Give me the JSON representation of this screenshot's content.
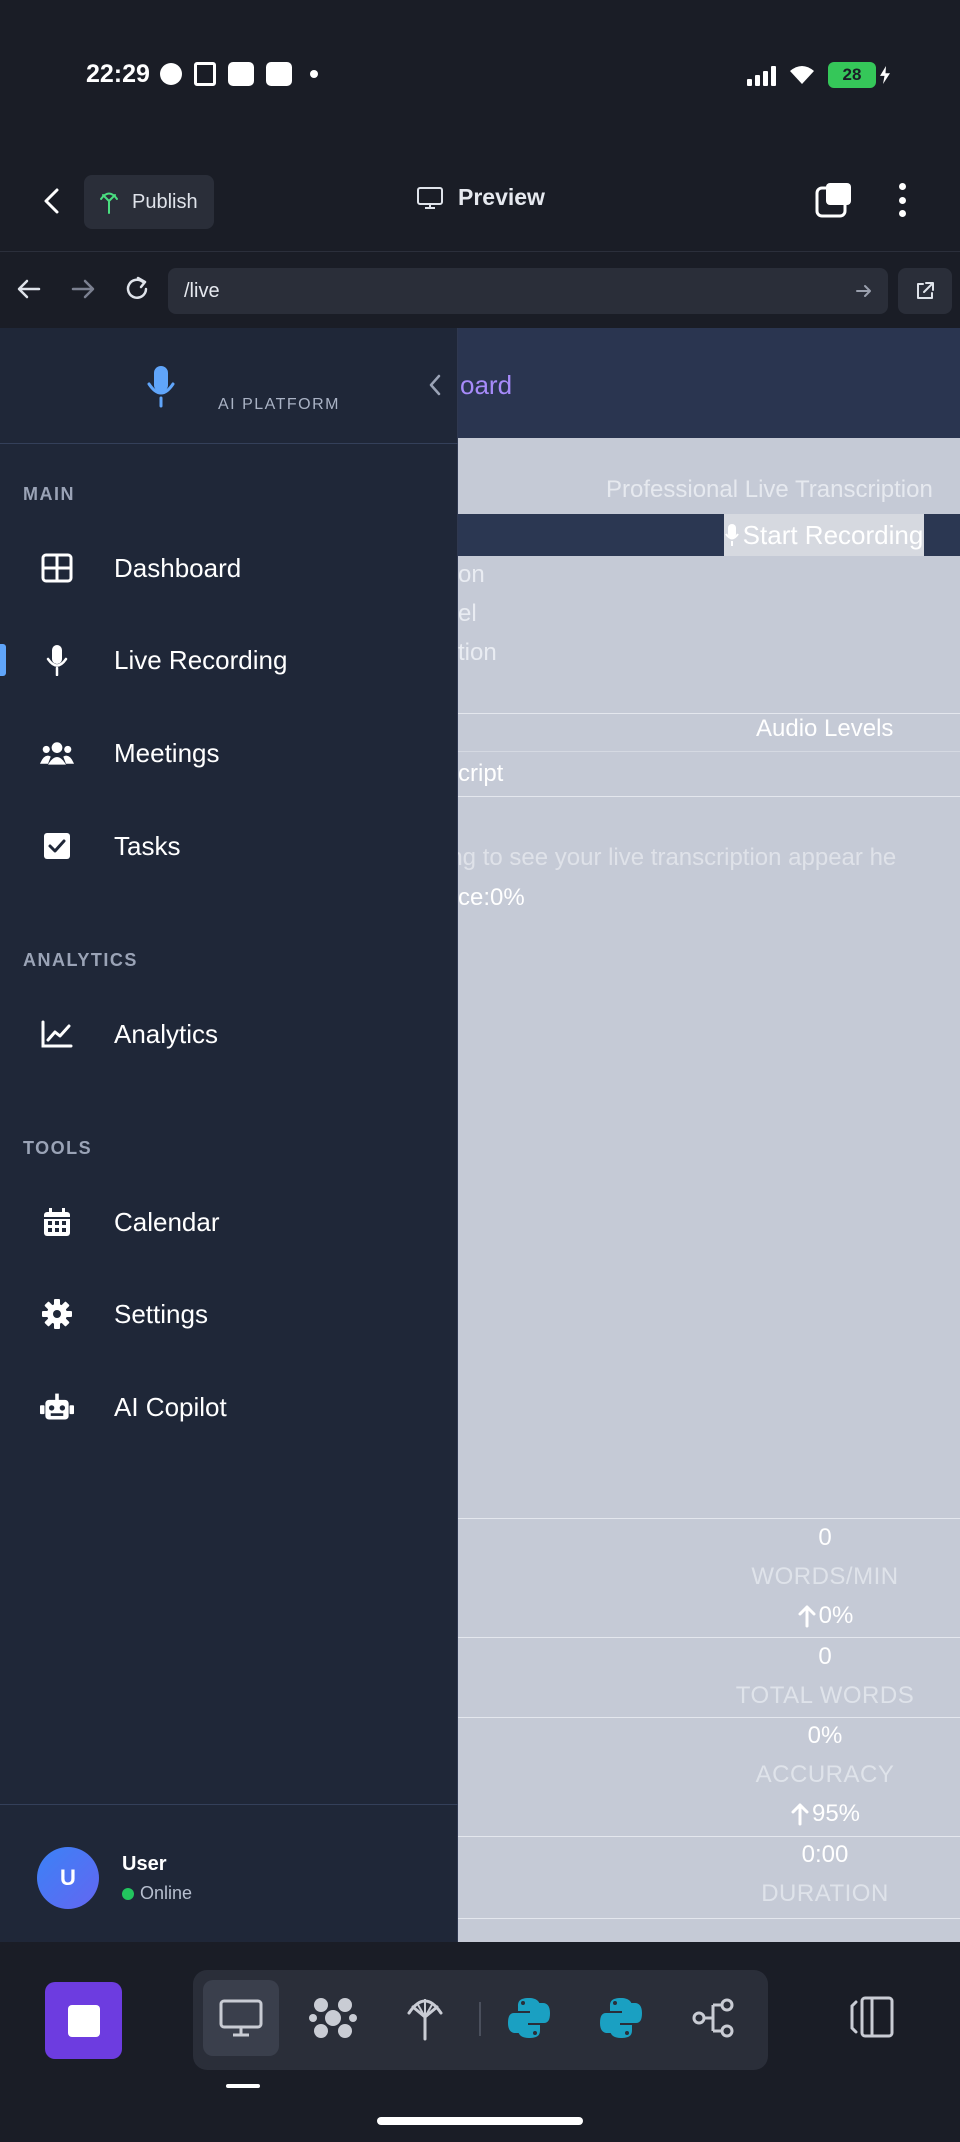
{
  "status_bar": {
    "time": "22:29",
    "battery": "28"
  },
  "app_bar": {
    "publish_label": "Publish",
    "preview_label": "Preview"
  },
  "browser": {
    "url": "/live"
  },
  "sidebar": {
    "brand": "AI PLATFORM",
    "groups": [
      {
        "label": "MAIN"
      },
      {
        "label": "ANALYTICS"
      },
      {
        "label": "TOOLS"
      }
    ],
    "items": [
      {
        "label": "Dashboard",
        "icon": "grid-icon"
      },
      {
        "label": "Live Recording",
        "icon": "microphone-icon",
        "active": true
      },
      {
        "label": "Meetings",
        "icon": "users-icon"
      },
      {
        "label": "Tasks",
        "icon": "checkbox-icon"
      },
      {
        "label": "Analytics",
        "icon": "line-chart-icon"
      },
      {
        "label": "Calendar",
        "icon": "calendar-icon"
      },
      {
        "label": "Settings",
        "icon": "gear-icon"
      },
      {
        "label": "AI Copilot",
        "icon": "robot-icon"
      }
    ],
    "user": {
      "initial": "U",
      "name": "User",
      "status": "Online"
    }
  },
  "page": {
    "header_title_fragment": "oard",
    "subtitle": "Professional Live Transcription",
    "start_recording_label": "Start Recording",
    "cut_lines": [
      "on",
      "el",
      "tion"
    ],
    "audio_levels_label": "Audio Levels",
    "transcript_label": "cript",
    "placeholder": "king to see your live transcription appear he",
    "confidence": "ce:0%",
    "stats": [
      {
        "value": "0",
        "label": "WORDS/MIN",
        "trend": "0%"
      },
      {
        "value": "0",
        "label": "TOTAL WORDS"
      },
      {
        "value": "0%",
        "label": "ACCURACY",
        "trend": "95%"
      },
      {
        "value": "0:00",
        "label": "DURATION"
      }
    ]
  },
  "colors": {
    "accent": "#60a5fa",
    "brand_purple": "#6d3ce0",
    "header_title": "#a78bfa"
  }
}
